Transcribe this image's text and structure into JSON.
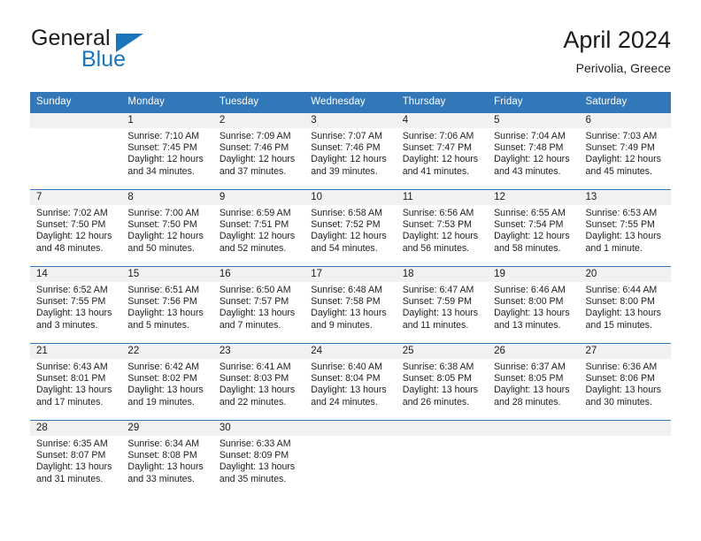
{
  "brand": {
    "name_part1": "General",
    "name_part2": "Blue",
    "logo_icon": "triangle-flag-icon"
  },
  "header": {
    "title": "April 2024",
    "location": "Perivolia, Greece"
  },
  "calendar": {
    "weekday_headers": [
      "Sunday",
      "Monday",
      "Tuesday",
      "Wednesday",
      "Thursday",
      "Friday",
      "Saturday"
    ],
    "accent_color": "#3277b7",
    "daynum_band_color": "#f1f1f1",
    "weeks": [
      [
        {
          "day": "",
          "sunrise": "",
          "sunset": "",
          "daylight_line1": "",
          "daylight_line2": ""
        },
        {
          "day": "1",
          "sunrise": "Sunrise: 7:10 AM",
          "sunset": "Sunset: 7:45 PM",
          "daylight_line1": "Daylight: 12 hours",
          "daylight_line2": "and 34 minutes."
        },
        {
          "day": "2",
          "sunrise": "Sunrise: 7:09 AM",
          "sunset": "Sunset: 7:46 PM",
          "daylight_line1": "Daylight: 12 hours",
          "daylight_line2": "and 37 minutes."
        },
        {
          "day": "3",
          "sunrise": "Sunrise: 7:07 AM",
          "sunset": "Sunset: 7:46 PM",
          "daylight_line1": "Daylight: 12 hours",
          "daylight_line2": "and 39 minutes."
        },
        {
          "day": "4",
          "sunrise": "Sunrise: 7:06 AM",
          "sunset": "Sunset: 7:47 PM",
          "daylight_line1": "Daylight: 12 hours",
          "daylight_line2": "and 41 minutes."
        },
        {
          "day": "5",
          "sunrise": "Sunrise: 7:04 AM",
          "sunset": "Sunset: 7:48 PM",
          "daylight_line1": "Daylight: 12 hours",
          "daylight_line2": "and 43 minutes."
        },
        {
          "day": "6",
          "sunrise": "Sunrise: 7:03 AM",
          "sunset": "Sunset: 7:49 PM",
          "daylight_line1": "Daylight: 12 hours",
          "daylight_line2": "and 45 minutes."
        }
      ],
      [
        {
          "day": "7",
          "sunrise": "Sunrise: 7:02 AM",
          "sunset": "Sunset: 7:50 PM",
          "daylight_line1": "Daylight: 12 hours",
          "daylight_line2": "and 48 minutes."
        },
        {
          "day": "8",
          "sunrise": "Sunrise: 7:00 AM",
          "sunset": "Sunset: 7:50 PM",
          "daylight_line1": "Daylight: 12 hours",
          "daylight_line2": "and 50 minutes."
        },
        {
          "day": "9",
          "sunrise": "Sunrise: 6:59 AM",
          "sunset": "Sunset: 7:51 PM",
          "daylight_line1": "Daylight: 12 hours",
          "daylight_line2": "and 52 minutes."
        },
        {
          "day": "10",
          "sunrise": "Sunrise: 6:58 AM",
          "sunset": "Sunset: 7:52 PM",
          "daylight_line1": "Daylight: 12 hours",
          "daylight_line2": "and 54 minutes."
        },
        {
          "day": "11",
          "sunrise": "Sunrise: 6:56 AM",
          "sunset": "Sunset: 7:53 PM",
          "daylight_line1": "Daylight: 12 hours",
          "daylight_line2": "and 56 minutes."
        },
        {
          "day": "12",
          "sunrise": "Sunrise: 6:55 AM",
          "sunset": "Sunset: 7:54 PM",
          "daylight_line1": "Daylight: 12 hours",
          "daylight_line2": "and 58 minutes."
        },
        {
          "day": "13",
          "sunrise": "Sunrise: 6:53 AM",
          "sunset": "Sunset: 7:55 PM",
          "daylight_line1": "Daylight: 13 hours",
          "daylight_line2": "and 1 minute."
        }
      ],
      [
        {
          "day": "14",
          "sunrise": "Sunrise: 6:52 AM",
          "sunset": "Sunset: 7:55 PM",
          "daylight_line1": "Daylight: 13 hours",
          "daylight_line2": "and 3 minutes."
        },
        {
          "day": "15",
          "sunrise": "Sunrise: 6:51 AM",
          "sunset": "Sunset: 7:56 PM",
          "daylight_line1": "Daylight: 13 hours",
          "daylight_line2": "and 5 minutes."
        },
        {
          "day": "16",
          "sunrise": "Sunrise: 6:50 AM",
          "sunset": "Sunset: 7:57 PM",
          "daylight_line1": "Daylight: 13 hours",
          "daylight_line2": "and 7 minutes."
        },
        {
          "day": "17",
          "sunrise": "Sunrise: 6:48 AM",
          "sunset": "Sunset: 7:58 PM",
          "daylight_line1": "Daylight: 13 hours",
          "daylight_line2": "and 9 minutes."
        },
        {
          "day": "18",
          "sunrise": "Sunrise: 6:47 AM",
          "sunset": "Sunset: 7:59 PM",
          "daylight_line1": "Daylight: 13 hours",
          "daylight_line2": "and 11 minutes."
        },
        {
          "day": "19",
          "sunrise": "Sunrise: 6:46 AM",
          "sunset": "Sunset: 8:00 PM",
          "daylight_line1": "Daylight: 13 hours",
          "daylight_line2": "and 13 minutes."
        },
        {
          "day": "20",
          "sunrise": "Sunrise: 6:44 AM",
          "sunset": "Sunset: 8:00 PM",
          "daylight_line1": "Daylight: 13 hours",
          "daylight_line2": "and 15 minutes."
        }
      ],
      [
        {
          "day": "21",
          "sunrise": "Sunrise: 6:43 AM",
          "sunset": "Sunset: 8:01 PM",
          "daylight_line1": "Daylight: 13 hours",
          "daylight_line2": "and 17 minutes."
        },
        {
          "day": "22",
          "sunrise": "Sunrise: 6:42 AM",
          "sunset": "Sunset: 8:02 PM",
          "daylight_line1": "Daylight: 13 hours",
          "daylight_line2": "and 19 minutes."
        },
        {
          "day": "23",
          "sunrise": "Sunrise: 6:41 AM",
          "sunset": "Sunset: 8:03 PM",
          "daylight_line1": "Daylight: 13 hours",
          "daylight_line2": "and 22 minutes."
        },
        {
          "day": "24",
          "sunrise": "Sunrise: 6:40 AM",
          "sunset": "Sunset: 8:04 PM",
          "daylight_line1": "Daylight: 13 hours",
          "daylight_line2": "and 24 minutes."
        },
        {
          "day": "25",
          "sunrise": "Sunrise: 6:38 AM",
          "sunset": "Sunset: 8:05 PM",
          "daylight_line1": "Daylight: 13 hours",
          "daylight_line2": "and 26 minutes."
        },
        {
          "day": "26",
          "sunrise": "Sunrise: 6:37 AM",
          "sunset": "Sunset: 8:05 PM",
          "daylight_line1": "Daylight: 13 hours",
          "daylight_line2": "and 28 minutes."
        },
        {
          "day": "27",
          "sunrise": "Sunrise: 6:36 AM",
          "sunset": "Sunset: 8:06 PM",
          "daylight_line1": "Daylight: 13 hours",
          "daylight_line2": "and 30 minutes."
        }
      ],
      [
        {
          "day": "28",
          "sunrise": "Sunrise: 6:35 AM",
          "sunset": "Sunset: 8:07 PM",
          "daylight_line1": "Daylight: 13 hours",
          "daylight_line2": "and 31 minutes."
        },
        {
          "day": "29",
          "sunrise": "Sunrise: 6:34 AM",
          "sunset": "Sunset: 8:08 PM",
          "daylight_line1": "Daylight: 13 hours",
          "daylight_line2": "and 33 minutes."
        },
        {
          "day": "30",
          "sunrise": "Sunrise: 6:33 AM",
          "sunset": "Sunset: 8:09 PM",
          "daylight_line1": "Daylight: 13 hours",
          "daylight_line2": "and 35 minutes."
        },
        {
          "day": "",
          "sunrise": "",
          "sunset": "",
          "daylight_line1": "",
          "daylight_line2": ""
        },
        {
          "day": "",
          "sunrise": "",
          "sunset": "",
          "daylight_line1": "",
          "daylight_line2": ""
        },
        {
          "day": "",
          "sunrise": "",
          "sunset": "",
          "daylight_line1": "",
          "daylight_line2": ""
        },
        {
          "day": "",
          "sunrise": "",
          "sunset": "",
          "daylight_line1": "",
          "daylight_line2": ""
        }
      ]
    ]
  }
}
